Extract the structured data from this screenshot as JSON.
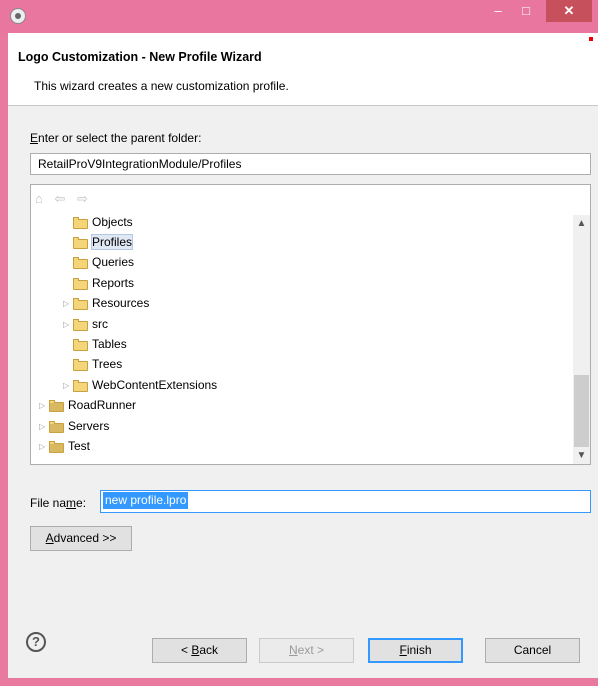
{
  "window": {
    "icon": "eclipse-gear-icon",
    "minimize": "–",
    "maximize": "□",
    "close": "✕"
  },
  "header": {
    "title": "Logo Customization - New Profile Wizard",
    "description": "This wizard creates a new customization profile."
  },
  "parent_folder": {
    "label_accel": "E",
    "label_rest": "nter or select the parent folder:",
    "value": "RetailProV9IntegrationModule/Profiles"
  },
  "tree": {
    "nav_icons": "⌂ ⇦ ⇨",
    "items": [
      {
        "label": "Objects",
        "expandable": false,
        "selected": false
      },
      {
        "label": "Profiles",
        "expandable": false,
        "selected": true
      },
      {
        "label": "Queries",
        "expandable": false,
        "selected": false
      },
      {
        "label": "Reports",
        "expandable": false,
        "selected": false
      },
      {
        "label": "Resources",
        "expandable": true,
        "selected": false
      },
      {
        "label": "src",
        "expandable": true,
        "selected": false
      },
      {
        "label": "Tables",
        "expandable": false,
        "selected": false
      },
      {
        "label": "Trees",
        "expandable": false,
        "selected": false
      },
      {
        "label": "WebContentExtensions",
        "expandable": true,
        "selected": false
      },
      {
        "label": "RoadRunner",
        "expandable": true,
        "selected": false
      },
      {
        "label": "Servers",
        "expandable": true,
        "selected": false
      },
      {
        "label": "Test",
        "expandable": true,
        "selected": false
      }
    ]
  },
  "file_name": {
    "label_pre": "File na",
    "label_accel": "m",
    "label_post": "e:",
    "value": "new profile.lpro"
  },
  "advanced": {
    "accel": "A",
    "rest": "dvanced >>"
  },
  "buttons": {
    "back": {
      "pre": "< ",
      "accel": "B",
      "rest": "ack"
    },
    "next": {
      "accel": "N",
      "rest": "ext >"
    },
    "finish": {
      "accel": "F",
      "rest": "inish"
    },
    "cancel": "Cancel"
  },
  "help": "?",
  "colors": {
    "title_bar": "#e8769e",
    "close_button": "#c7505d",
    "selection": "#3399ff"
  }
}
